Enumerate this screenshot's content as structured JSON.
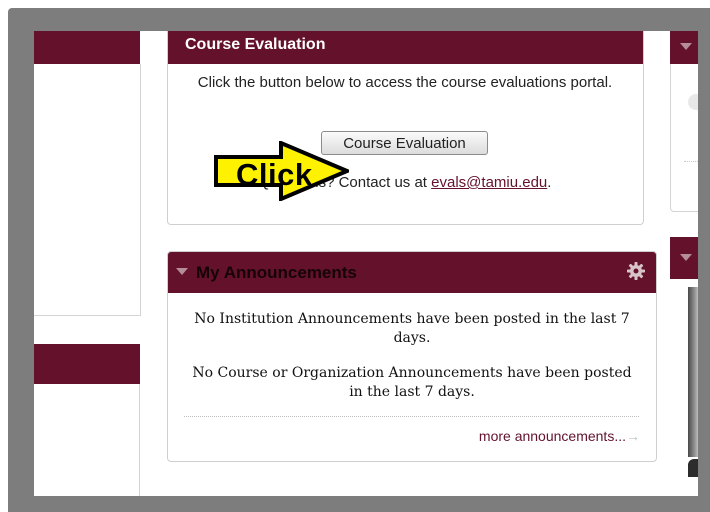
{
  "course_evaluation": {
    "title": "Course Evaluation",
    "description": "Click the button below to access the course evaluations portal.",
    "button_label": "Course Evaluation",
    "questions_prefix": "Questions? Contact us at ",
    "contact_email": "evals@tamiu.edu",
    "questions_suffix": "."
  },
  "announcements": {
    "title": "My Announcements",
    "institution_message": "No Institution Announcements have been posted in the last 7 days.",
    "course_message": "No Course or Organization Announcements have been posted in the last 7 days.",
    "more_link": "more announcements...",
    "more_arrow": "→"
  },
  "callout": {
    "label": "Click",
    "fill_color": "#fff200",
    "outline_color": "#000000"
  },
  "colors": {
    "header_maroon": "#64122c",
    "frame_gray": "#7d7d7d"
  },
  "icons": {
    "gear": "gear-icon",
    "chevron": "chevron-down-icon"
  }
}
